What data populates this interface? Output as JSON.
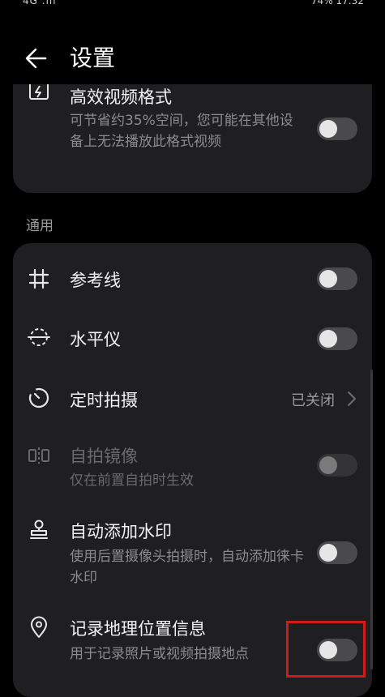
{
  "status": {
    "left": "4G  .ıll",
    "right": "74%  17:32"
  },
  "header": {
    "title": "设置"
  },
  "top_card": {
    "item": {
      "icon": "video-format-icon",
      "title": "高效视频格式",
      "subtitle": "可节省约35%空间，您可能在其他设备上无法播放此格式视频",
      "enabled": false
    }
  },
  "section": {
    "label": "通用"
  },
  "items": [
    {
      "icon": "grid-icon",
      "title": "参考线",
      "enabled": false
    },
    {
      "icon": "level-icon",
      "title": "水平仪",
      "enabled": false
    },
    {
      "icon": "timer-icon",
      "title": "定时拍摄",
      "value": "已关闭"
    },
    {
      "icon": "mirror-icon",
      "title": "自拍镜像",
      "subtitle": "仅在前置自拍时生效",
      "enabled": false,
      "disabled": true
    },
    {
      "icon": "watermark-icon",
      "title": "自动添加水印",
      "subtitle": "使用后置摄像头拍摄时，自动添加徕卡水印",
      "enabled": false
    },
    {
      "icon": "location-pin-icon",
      "title": "记录地理位置信息",
      "subtitle": "用于记录照片或视频拍摄地点",
      "enabled": false
    }
  ],
  "colors": {
    "background": "#000000",
    "card": "#1f1f21",
    "toggle_off": "#4a4a4c",
    "highlight": "#d11a1a"
  }
}
